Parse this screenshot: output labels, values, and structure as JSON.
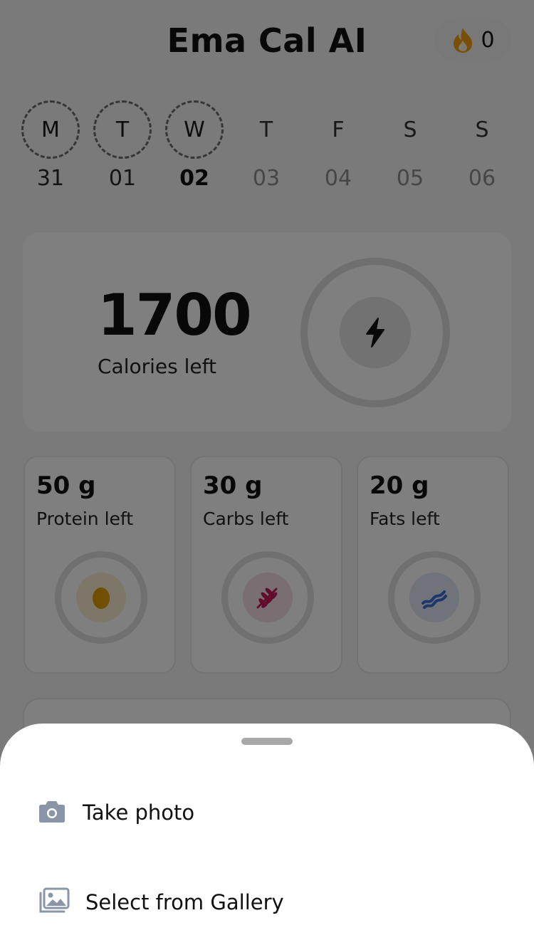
{
  "app": {
    "title": "Ema Cal AI",
    "streak_count": "0",
    "streak_icon": "flame-icon"
  },
  "week": [
    {
      "letter": "M",
      "date": "31",
      "state": "logged"
    },
    {
      "letter": "T",
      "date": "01",
      "state": "logged"
    },
    {
      "letter": "W",
      "date": "02",
      "state": "current"
    },
    {
      "letter": "T",
      "date": "03",
      "state": "future"
    },
    {
      "letter": "F",
      "date": "04",
      "state": "future"
    },
    {
      "letter": "S",
      "date": "05",
      "state": "future"
    },
    {
      "letter": "S",
      "date": "06",
      "state": "future"
    }
  ],
  "calories": {
    "value": "1700",
    "label": "Calories left",
    "icon": "lightning-icon"
  },
  "macros": [
    {
      "value": "50 g",
      "label": "Protein left",
      "icon": "egg-icon",
      "color": "#e0a100",
      "tint": "#f8efd2"
    },
    {
      "value": "30 g",
      "label": "Carbs left",
      "icon": "wheat-icon",
      "color": "#c2185b",
      "tint": "#f3dfe4"
    },
    {
      "value": "20 g",
      "label": "Fats left",
      "icon": "bacon-icon",
      "color": "#3b6fd4",
      "tint": "#e0e7f3"
    }
  ],
  "sheet": {
    "options": [
      {
        "label": "Take photo",
        "icon": "camera-icon"
      },
      {
        "label": "Select from Gallery",
        "icon": "gallery-icon"
      }
    ]
  },
  "colors": {
    "scrim": "rgba(0,0,0,0.5)",
    "streak_flame": "#f39c12",
    "sheet_icon": "#8a96a8"
  }
}
